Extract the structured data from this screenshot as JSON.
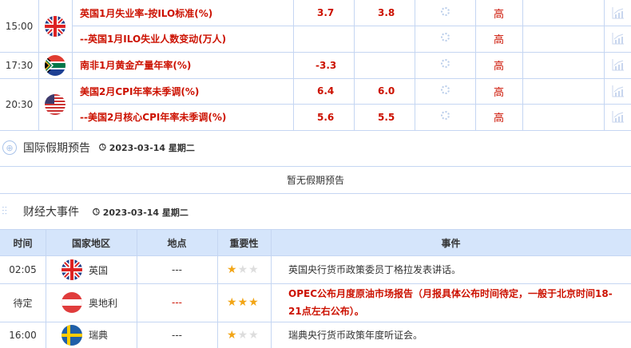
{
  "indicators": [
    {
      "time": "15:00",
      "event": "英国1月失业率-按ILO标准(%)",
      "actual": "3.7",
      "previous": "3.8",
      "importance": "高"
    },
    {
      "time": "",
      "event": "--英国1月ILO失业人数变动(万人)",
      "actual": "",
      "previous": "",
      "importance": "高"
    },
    {
      "time": "17:30",
      "event": "南非1月黄金产量年率(%)",
      "actual": "-3.3",
      "previous": "",
      "importance": "高"
    },
    {
      "time": "20:30",
      "event": "美国2月CPI年率未季调(%)",
      "actual": "6.4",
      "previous": "6.0",
      "importance": "高"
    },
    {
      "time": "",
      "event": "--美国2月核心CPI年率未季调(%)",
      "actual": "5.6",
      "previous": "5.5",
      "importance": "高"
    }
  ],
  "holiday": {
    "title": "国际假期预告",
    "date": "2023-03-14 星期二",
    "empty": "暂无假期预告"
  },
  "events": {
    "title": "财经大事件",
    "date": "2023-03-14 星期二",
    "headers": [
      "时间",
      "国家地区",
      "地点",
      "重要性",
      "事件"
    ],
    "rows": [
      {
        "time": "02:05",
        "country": "英国",
        "place": "---",
        "stars": 1,
        "event": "英国央行货币政策委员丁格拉发表讲话。"
      },
      {
        "time": "待定",
        "country": "奥地利",
        "place": "---",
        "stars": 3,
        "event": "OPEC公布月度原油市场报告（月报具体公布时间待定，一般于北京时间18-21点左右公布）。"
      },
      {
        "time": "16:00",
        "country": "瑞典",
        "place": "---",
        "stars": 1,
        "event": "瑞典央行货币政策年度听证会。"
      }
    ]
  },
  "colors": {
    "accent_red": "#cc1100",
    "header_bg": "#d5e5fb",
    "border": "#c5d6f2"
  }
}
